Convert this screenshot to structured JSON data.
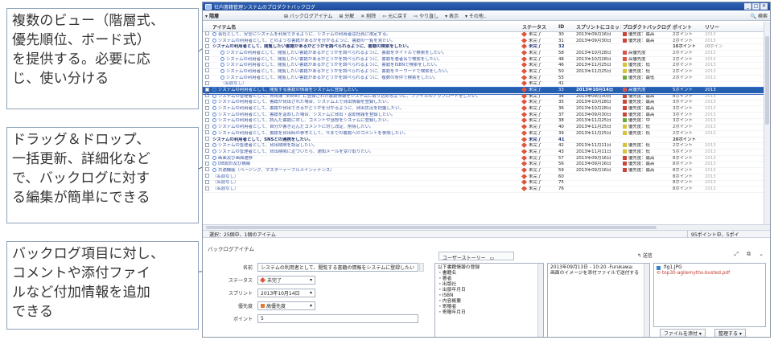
{
  "callouts": [
    "複数のビュー（階層式、\n優先順位、ボード式）\nを提供する。必要に応\nじ、使い分ける",
    "ドラッグ＆ドロップ、\n一括更新、詳細化など\nで、バックログに対す\nる編集が簡単にできる",
    "バックログ項目に対し、\nコメントや添付ファイ\nルなど付加情報を追加\nできる"
  ],
  "window": {
    "title": "社内書籍管理システムのプロダクトバックログ"
  },
  "toolbar": {
    "view": "▾ 階層",
    "items": [
      "⊞ バックログアイテム",
      "⊞ 分解",
      "✕ 削除",
      "⇦ 元に戻す",
      "⇨ やり直し",
      "▾ 表示",
      "▾ その他.."
    ],
    "search": "🔍 検索"
  },
  "grid": {
    "headers": {
      "name": "アイテム名",
      "status": "ステータス",
      "id": "ID",
      "sprint": "スプリントにコミット",
      "priority": "プロダクトバックログの優先度",
      "point": "ポイント",
      "release": "リリー"
    },
    "rows": [
      {
        "kind": "item",
        "indent": 0,
        "name": "会社として、安全にシステムを利用できるように、システムの利用者は社員に限定する。",
        "status": "未完了",
        "id": "30",
        "sprint": "2013年09月16日",
        "priority": "優先度：最高",
        "pc": "#c8453a",
        "point": "2ポイント",
        "rel": "2013"
      },
      {
        "kind": "item",
        "indent": 0,
        "name": "システムの利用者として、どのような書籍があるかを分かるように、書籍の一覧を見たい。",
        "status": "未完了",
        "id": "31",
        "sprint": "2013年09月30日",
        "priority": "優先度：最高",
        "pc": "#c8453a",
        "point": "2ポイント",
        "rel": "2013"
      },
      {
        "kind": "group",
        "indent": 0,
        "name": "システムの利用者として、閲覧したい書籍があるかどうかを調べられるように、書籍の検索をしたい。",
        "status": "未完了",
        "id": "32",
        "sprint": "",
        "priority": "",
        "pc": "",
        "point": "16ポイント",
        "rel": "(0ポイン"
      },
      {
        "kind": "item",
        "indent": 1,
        "name": "システムの利用者として、閲覧したい書籍があるかどうかを調べられるように、書籍をタイトルで検索をしたい。",
        "status": "未完了",
        "id": "58",
        "sprint": "2013年10月28日",
        "priority": "高優先度",
        "pc": "#d9534a",
        "point": "2ポイント",
        "rel": "2013"
      },
      {
        "kind": "item",
        "indent": 1,
        "name": "システムの利用者として、閲覧したい書籍があるかどうかを調べられるように、書籍を著者名で検索をしたい。",
        "status": "未完了",
        "id": "48",
        "sprint": "2013年10月28日",
        "priority": "高優先度",
        "pc": "#d9534a",
        "point": "2ポイント",
        "rel": "2013"
      },
      {
        "kind": "item",
        "indent": 1,
        "name": "システムの利用者として、閲覧したい書籍があるかどうかを調べられるように、書籍をISBNで検索をしたい。",
        "status": "未完了",
        "id": "46",
        "sprint": "2013年11月25日",
        "priority": "優先度：低",
        "pc": "#d7c23a",
        "point": "2ポイント",
        "rel": "2013"
      },
      {
        "kind": "item",
        "indent": 1,
        "name": "システムの利用者として、閲覧したい書籍があるかどうかを調べられるように、書籍をキーワードで検索をしたい。",
        "status": "未完了",
        "id": "50",
        "sprint": "2013年11月25日",
        "priority": "優先度：低",
        "pc": "#d7c23a",
        "point": "2ポイント",
        "rel": "2013"
      },
      {
        "kind": "item",
        "indent": 1,
        "name": "システムの利用者として、閲覧したい書籍があるかどうかを調べられるように、複数の条件で検索をしたい。",
        "status": "未完了",
        "id": "55",
        "sprint": "",
        "priority": "優先度：最低",
        "pc": "#6aaa3c",
        "point": "2ポイント",
        "rel": "2013"
      },
      {
        "kind": "blank",
        "indent": 1,
        "name": "（名前なし）",
        "status": "未完了",
        "id": "41",
        "sprint": "",
        "priority": "",
        "pc": "",
        "point": "",
        "rel": ""
      },
      {
        "kind": "selected",
        "indent": 0,
        "name": "システムの利用者として、閲覧する書籍の情報をシステムに登録したい。",
        "status": "未完了",
        "id": "33",
        "sprint": "2013年10月14日",
        "priority": "高優先度",
        "pc": "#d9534a",
        "point": "5ポイント",
        "rel": "2013"
      },
      {
        "kind": "item",
        "indent": 0,
        "name": "システムの管理者として、貸出簿（Excel）に登録された書籍情報をシステムに取り込めるように、ファイルのアップロードをしたい。",
        "status": "未完了",
        "id": "34",
        "sprint": "2013年09月30日",
        "priority": "優先度：最高",
        "pc": "#c8453a",
        "point": "8ポイント",
        "rel": "2013"
      },
      {
        "kind": "item",
        "indent": 0,
        "name": "システムの利用者として、書籍が貸出された場合、システム上で貸出情報を登録したい。",
        "status": "未完了",
        "id": "35",
        "sprint": "2013年10月28日",
        "priority": "優先度：最高",
        "pc": "#c8453a",
        "point": "3ポイント",
        "rel": "2013"
      },
      {
        "kind": "item",
        "indent": 0,
        "name": "システムの利用者として、書籍が貸出できるかどうかを分かるように、貸出状況を把握したい。",
        "status": "未完了",
        "id": "36",
        "sprint": "2013年10月28日",
        "priority": "優先度：最高",
        "pc": "#c8453a",
        "point": "3ポイント",
        "rel": "2013"
      },
      {
        "kind": "item",
        "indent": 0,
        "name": "システムの利用者として、書籍を返却した場合、システムに貸出・返却情報を登録したい。",
        "status": "未完了",
        "id": "37",
        "sprint": "2013年09月30日",
        "priority": "優先度：最高",
        "pc": "#c8453a",
        "point": "3ポイント",
        "rel": "2013"
      },
      {
        "kind": "item",
        "indent": 0,
        "name": "システムの利用者として、読んだ書籍に対し、コメントや感想をシステムに登録したい。",
        "status": "未完了",
        "id": "38",
        "sprint": "2013年11月25日",
        "priority": "優先度：中",
        "pc": "#6aaa3c",
        "point": "3ポイント",
        "rel": "2013"
      },
      {
        "kind": "item",
        "indent": 0,
        "name": "システムの利用者として、自分が書き込んだコメントに対し改定、削除したい。",
        "status": "未完了",
        "id": "40",
        "sprint": "2013年11月25日",
        "priority": "優先度：低",
        "pc": "#d7c23a",
        "point": "2ポイント",
        "rel": "2013"
      },
      {
        "kind": "item",
        "indent": 0,
        "name": "システムの利用者として、書籍を貸出時の参考として、今までの書籍へのコメントを参照したい。",
        "status": "未完了",
        "id": "39",
        "sprint": "2013年11月25日",
        "priority": "優先度：低",
        "pc": "#d7c23a",
        "point": "2ポイント",
        "rel": "2013"
      },
      {
        "kind": "group2",
        "indent": 0,
        "name": "システムの利用者として、SNSとの連携をしたい。",
        "status": "未完了",
        "id": "41",
        "sprint": "",
        "priority": "",
        "pc": "",
        "point": "20ポイント",
        "rel": ""
      },
      {
        "kind": "item",
        "indent": 0,
        "name": "システムの管理者として、貸出期間を設定したい。",
        "status": "未完了",
        "id": "42",
        "sprint": "2013年11月11日",
        "priority": "優先度：低",
        "pc": "#d7c23a",
        "point": "2ポイント",
        "rel": "2013"
      },
      {
        "kind": "item",
        "indent": 0,
        "name": "システムの管理者として、貸出期限に近づいたら、通知メールを受け取りたい。",
        "status": "未完了",
        "id": "43",
        "sprint": "2013年11月11日",
        "priority": "優先度：低",
        "pc": "#d7c23a",
        "point": "5ポイント",
        "rel": "2013"
      },
      {
        "kind": "item",
        "indent": 0,
        "name": "画面及び画面遷移",
        "status": "未完了",
        "id": "57",
        "sprint": "2013年09月16日",
        "priority": "優先度：最高",
        "pc": "#c8453a",
        "point": "8ポイント",
        "rel": "2013"
      },
      {
        "kind": "item",
        "indent": 0,
        "name": "DB設計及び構築",
        "status": "未完了",
        "id": "56",
        "sprint": "2013年09月16日",
        "priority": "優先度：最高",
        "pc": "#c8453a",
        "point": "8ポイント",
        "rel": "2013"
      },
      {
        "kind": "item",
        "indent": 0,
        "name": "共通機能（ページング、マスターテーブルメインテナンス）",
        "status": "未完了",
        "id": "59",
        "sprint": "2013年09月16日",
        "priority": "優先度：最高",
        "pc": "#c8453a",
        "point": "8ポイント",
        "rel": "2013"
      },
      {
        "kind": "blank",
        "indent": 0,
        "name": "（名前なし）",
        "status": "未完了",
        "id": "60",
        "sprint": "",
        "priority": "",
        "pc": "",
        "point": "8ポイント",
        "rel": "2013"
      },
      {
        "kind": "blank",
        "indent": 0,
        "name": "（名前なし）",
        "status": "未完了",
        "id": "75",
        "sprint": "",
        "priority": "",
        "pc": "",
        "point": "8ポイント",
        "rel": "2013"
      },
      {
        "kind": "blank",
        "indent": 0,
        "name": "（名前なし）",
        "status": "未完了",
        "id": "76",
        "sprint": "",
        "priority": "",
        "pc": "",
        "point": "8ポイント",
        "rel": "2013"
      }
    ]
  },
  "statusbar": {
    "left": "選択：25個中、1個のアイテム",
    "right": "95ポイント中、5ポイ"
  },
  "detail": {
    "title": "バックログアイテム",
    "tab": "ユーザーストーリー",
    "send": "↰ 送信",
    "fields": {
      "name_label": "名前",
      "name_value": "システムの利用者として、閲覧する書籍の情報をシステムに登録したい",
      "status_label": "ステータス",
      "status_value": "未完了",
      "sprint_label": "スプリント",
      "sprint_value": "2013年10月14日",
      "priority_label": "優先度",
      "priority_value": "高優先度",
      "point_label": "ポイント",
      "point_value": "5"
    },
    "story_lines": [
      "以下書籍情報の登録",
      "・書籍名",
      "・著者",
      "・出版社",
      "・出版年月日",
      "・ISBN",
      "・内容概要",
      "・寄贈者",
      "・寄贈年月日"
    ],
    "comment_header": "2013年09月13日 - 10:20 -Furukawa:",
    "comment_body": "画面のイメージを添付ファイルで送付する",
    "attachments": [
      "fig1.JPG",
      "top30-agilemyths-busted.pdf"
    ],
    "buttons": {
      "attach": "ファイルを添付 ▾",
      "organize": "整理する ▾"
    }
  }
}
